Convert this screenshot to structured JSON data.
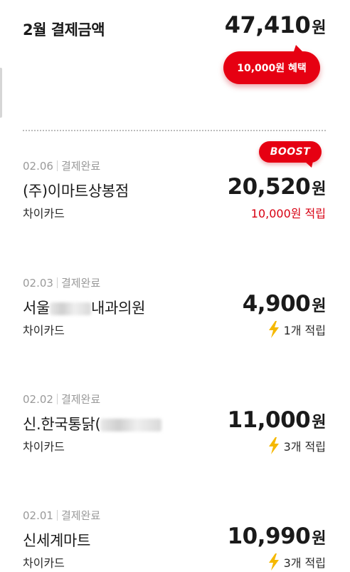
{
  "summary": {
    "title": "2월 결제금액",
    "amount": "47,410",
    "currency": "원",
    "benefit_badge": "10,000원 혜택"
  },
  "colors": {
    "accent": "#e60012",
    "bolt": "#f5b800",
    "muted": "#9a9a9a"
  },
  "transactions": [
    {
      "date": "02.06",
      "status": "결제완료",
      "merchant": "(주)이마트상봉점",
      "card": "차이카드",
      "amount": "20,520",
      "currency": "원",
      "badge": "BOOST",
      "reward": "10,000원 적립",
      "reward_icon": "none"
    },
    {
      "date": "02.03",
      "status": "결제완료",
      "merchant_prefix": "서울",
      "merchant_suffix": "내과의원",
      "card": "차이카드",
      "amount": "4,900",
      "currency": "원",
      "reward": "1개 적립",
      "reward_icon": "lightning-bolt-icon"
    },
    {
      "date": "02.02",
      "status": "결제완료",
      "merchant_prefix": "신.한국통닭(",
      "card": "차이카드",
      "amount": "11,000",
      "currency": "원",
      "reward": "3개 적립",
      "reward_icon": "lightning-bolt-icon"
    },
    {
      "date": "02.01",
      "status": "결제완료",
      "merchant": "신세계마트",
      "card": "차이카드",
      "amount": "10,990",
      "currency": "원",
      "reward": "3개 적립",
      "reward_icon": "lightning-bolt-icon"
    }
  ]
}
